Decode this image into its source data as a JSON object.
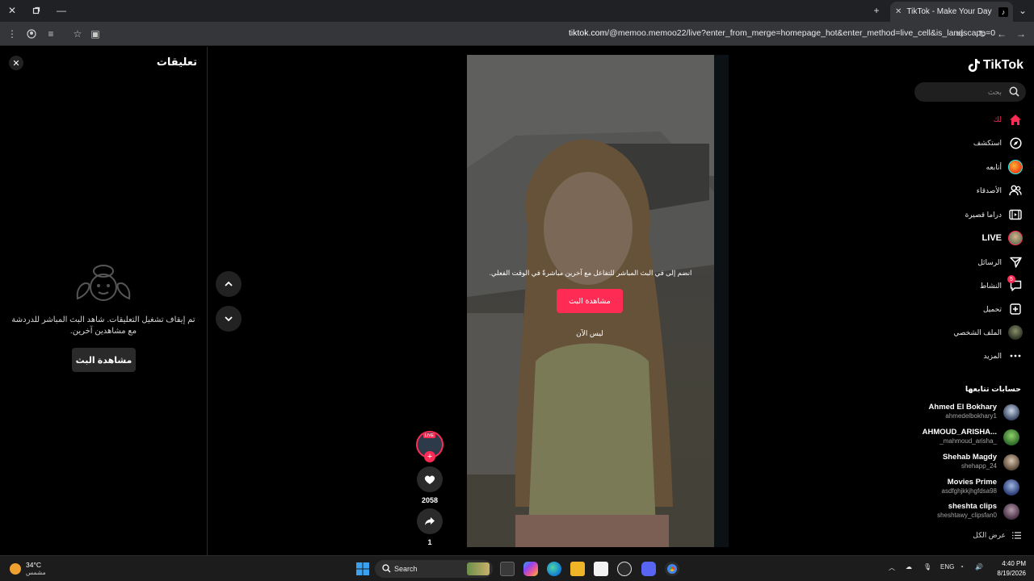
{
  "browser": {
    "tab_title": "TikTok - Make Your Day",
    "url_host": "tiktok.com",
    "url_path": "/@memoo.memoo22/live?enter_from_merge=homepage_hot&enter_method=live_cell&is_landscape=0"
  },
  "comments": {
    "title": "تعليقات",
    "message": "تم إيقاف تشغيل التعليقات. شاهد البث المباشر للدردشة مع مشاهدين آخرين.",
    "watch_button": "مشاهدة البث"
  },
  "video": {
    "prompt": "انضم إلى في البث المباشر للتفاعل مع آخرين مباشرةً في الوقت الفعلي.",
    "watch_button": "مشاهدة البث",
    "not_now": "ليس الآن",
    "live_tag": "LIVE"
  },
  "actions": {
    "likes": "2058",
    "shares": "1"
  },
  "sidebar": {
    "logo": "TikTok",
    "search_placeholder": "بحث",
    "nav": [
      {
        "label": "لك",
        "icon": "home-icon"
      },
      {
        "label": "استكشف",
        "icon": "compass-icon"
      },
      {
        "label": "أتابعه",
        "icon": "following-avatar-icon"
      },
      {
        "label": "الأصدقاء",
        "icon": "friends-icon"
      },
      {
        "label": "دراما قصيرة",
        "icon": "drama-icon"
      },
      {
        "label": "LIVE",
        "icon": "live-avatar-icon"
      },
      {
        "label": "الرسائل",
        "icon": "send-icon"
      },
      {
        "label": "النشاط",
        "icon": "activity-icon",
        "badge": "5"
      },
      {
        "label": "تحميل",
        "icon": "upload-icon"
      },
      {
        "label": "الملف الشخصي",
        "icon": "profile-avatar-icon"
      },
      {
        "label": "المزيد",
        "icon": "more-icon"
      }
    ],
    "following_title": "حسابات تتابعها",
    "accounts": [
      {
        "name": "Ahmed El Bokhary",
        "handle": "ahmedelbokhary1"
      },
      {
        "name": "AHMOUD_ARISHA...",
        "handle": "_mahmoud_arisha_"
      },
      {
        "name": "Shehab Magdy",
        "handle": "shehapp_24"
      },
      {
        "name": "Movies Prime",
        "handle": "asdfghjkkjhgfdsa98"
      },
      {
        "name": "sheshta clips",
        "handle": "sheshtawy_clipsfan0"
      }
    ],
    "see_all": "عرض الكل"
  },
  "taskbar": {
    "weather_temp": "34°C",
    "weather_desc": "مشمس",
    "search_label": "Search",
    "language": "ENG",
    "time": "4:40 PM",
    "date": "8/19/2026"
  },
  "colors": {
    "accent": "#fe2c55",
    "background": "#000000"
  }
}
